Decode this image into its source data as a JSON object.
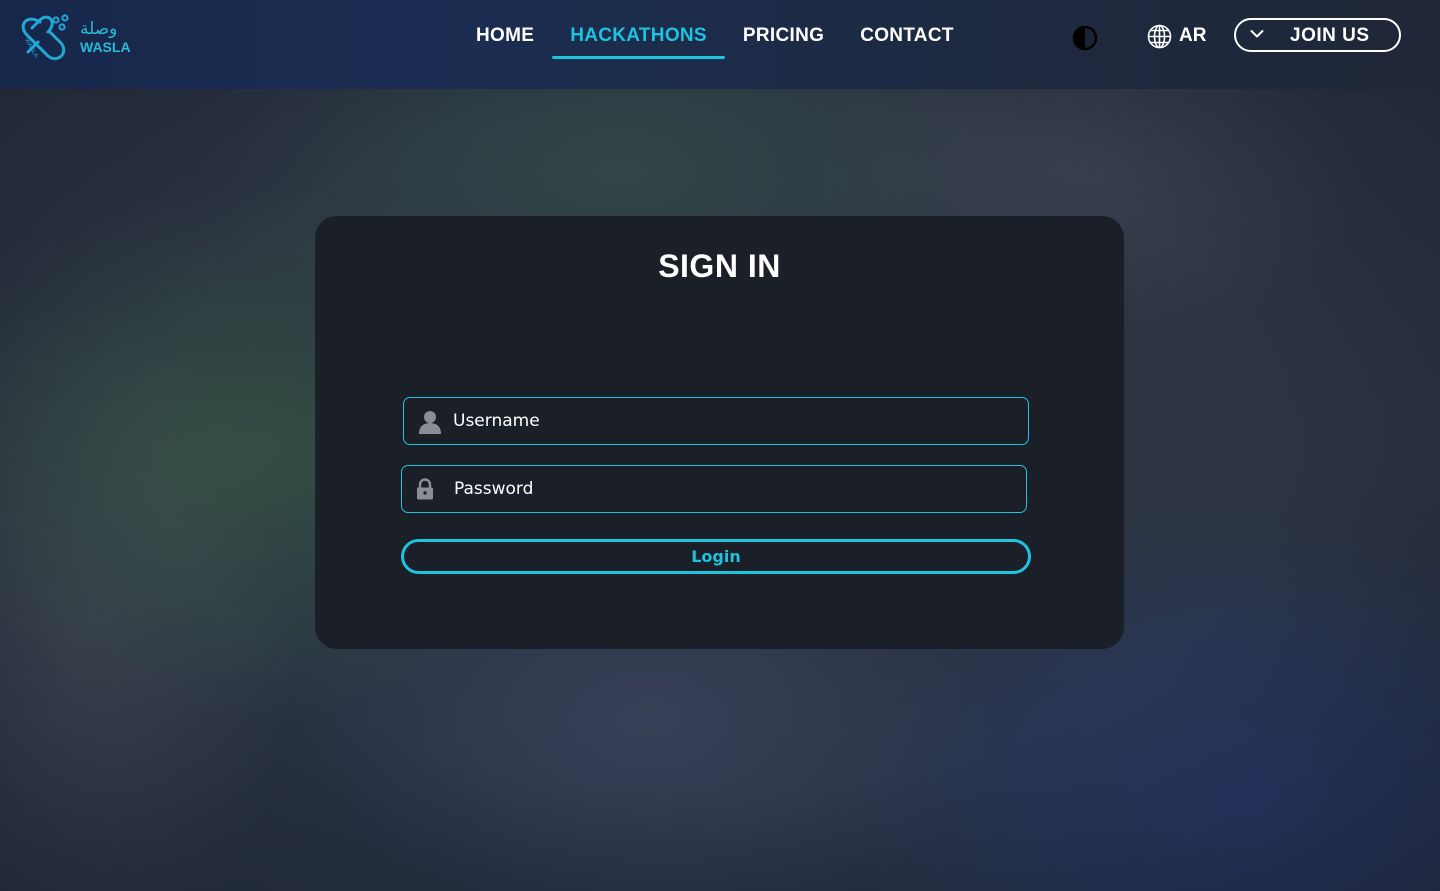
{
  "brand": {
    "name_arabic": "وصلة",
    "name_latin": "WASLA",
    "mark_text": "WASLA",
    "accent_color": "#1ec3e0"
  },
  "nav": {
    "items": [
      {
        "label": "HOME",
        "active": false
      },
      {
        "label": "HACKATHONS",
        "active": true
      },
      {
        "label": "PRICING",
        "active": false
      },
      {
        "label": "CONTACT",
        "active": false
      }
    ]
  },
  "header": {
    "theme_toggle_icon": "contrast-icon",
    "language_icon": "globe-icon",
    "language_label": "AR",
    "join_label": "JOIN US",
    "join_icon": "chevron-down-icon"
  },
  "signin": {
    "title": "SIGN IN",
    "username_placeholder": "Username",
    "username_value": "",
    "username_icon": "user-icon",
    "password_placeholder": "Password",
    "password_value": "",
    "password_icon": "lock-icon",
    "login_label": "Login"
  }
}
